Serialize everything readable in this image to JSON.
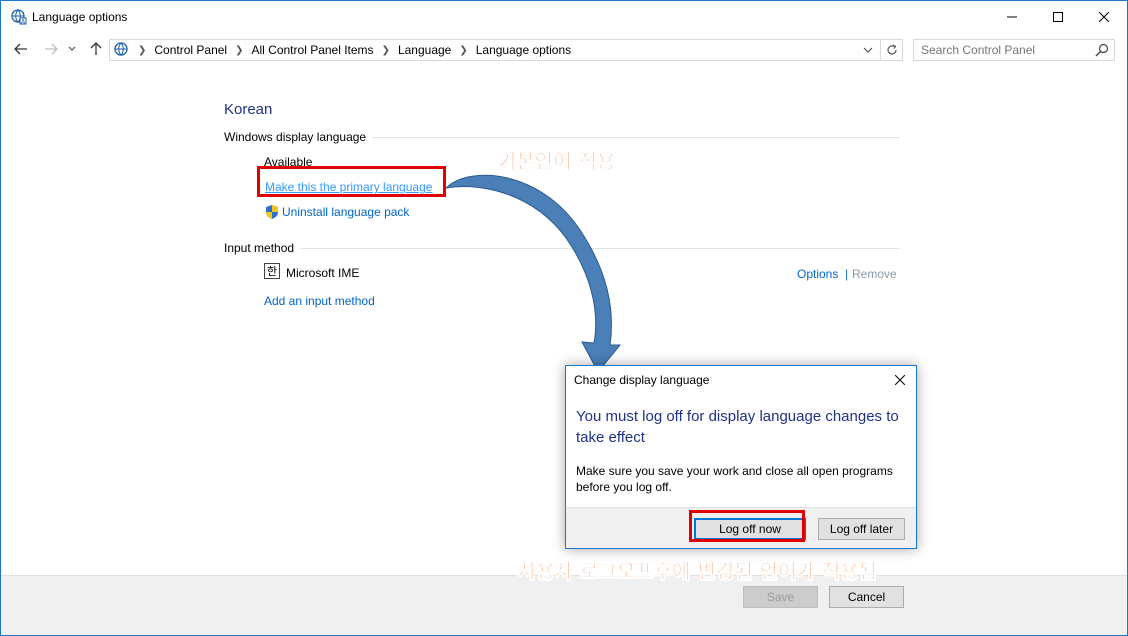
{
  "window": {
    "title": "Language options",
    "accent_color": "#1979ca"
  },
  "nav": {
    "breadcrumbs": [
      "Control Panel",
      "All Control Panel Items",
      "Language",
      "Language options"
    ],
    "search_placeholder": "Search Control Panel"
  },
  "content": {
    "language_name": "Korean",
    "display_section": {
      "heading": "Windows display language",
      "status": "Available",
      "primary_link": "Make this the primary language",
      "uninstall_link": "Uninstall language pack"
    },
    "input_section": {
      "heading": "Input method",
      "ime_badge": "한",
      "ime_name": "Microsoft IME",
      "options_link": "Options",
      "separator": "|",
      "remove_link": "Remove",
      "add_link": "Add an input method"
    }
  },
  "footer": {
    "save_label": "Save",
    "cancel_label": "Cancel"
  },
  "dialog": {
    "title": "Change display language",
    "heading": "You must log off for display language changes to take effect",
    "body": "Make sure you save your work and close all open programs before you log off.",
    "logoff_now": "Log off now",
    "logoff_later": "Log off later"
  },
  "annotations": {
    "top_note": "기본언어 적용",
    "bottom_note": "사용자 로그오프후에 변경된 언어가 적용됨",
    "highlight_color": "#e00000",
    "text_color": "#f08038",
    "arrow_color": "#4a7fb8"
  }
}
